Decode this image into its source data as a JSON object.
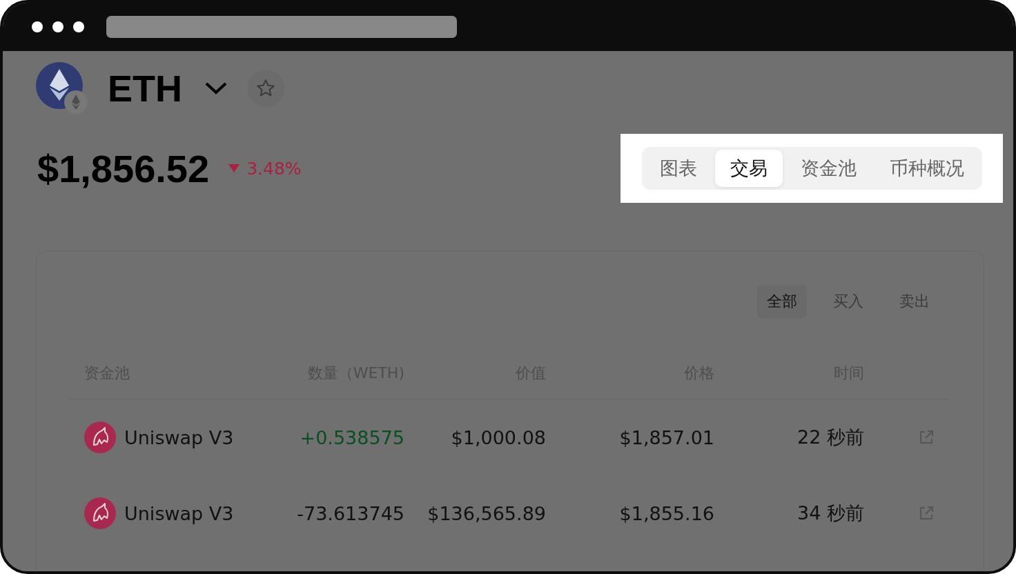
{
  "coin": {
    "symbol": "ETH",
    "favorite": false
  },
  "price": {
    "value": "$1,856.52",
    "change": "3.48%",
    "falling": true
  },
  "tabs": [
    {
      "label": "图表",
      "selected": false
    },
    {
      "label": "交易",
      "selected": true
    },
    {
      "label": "资金池",
      "selected": false
    },
    {
      "label": "币种概况",
      "selected": false
    }
  ],
  "filters": [
    {
      "label": "全部",
      "selected": true
    },
    {
      "label": "买入",
      "selected": false
    },
    {
      "label": "卖出",
      "selected": false
    }
  ],
  "table": {
    "columns": [
      "资金池",
      "数量（WETH)",
      "价值",
      "价格",
      "时间"
    ],
    "rows": [
      {
        "pool": "Uniswap V3",
        "kind": "buy",
        "amount": "+0.538575",
        "value": "$1,000.08",
        "price": "$1,857.01",
        "time": "22 秒前"
      },
      {
        "pool": "Uniswap V3",
        "kind": "sell",
        "amount": "-73.613745",
        "value": "$136,565.89",
        "price": "$1,855.16",
        "time": "34 秒前"
      }
    ]
  }
}
